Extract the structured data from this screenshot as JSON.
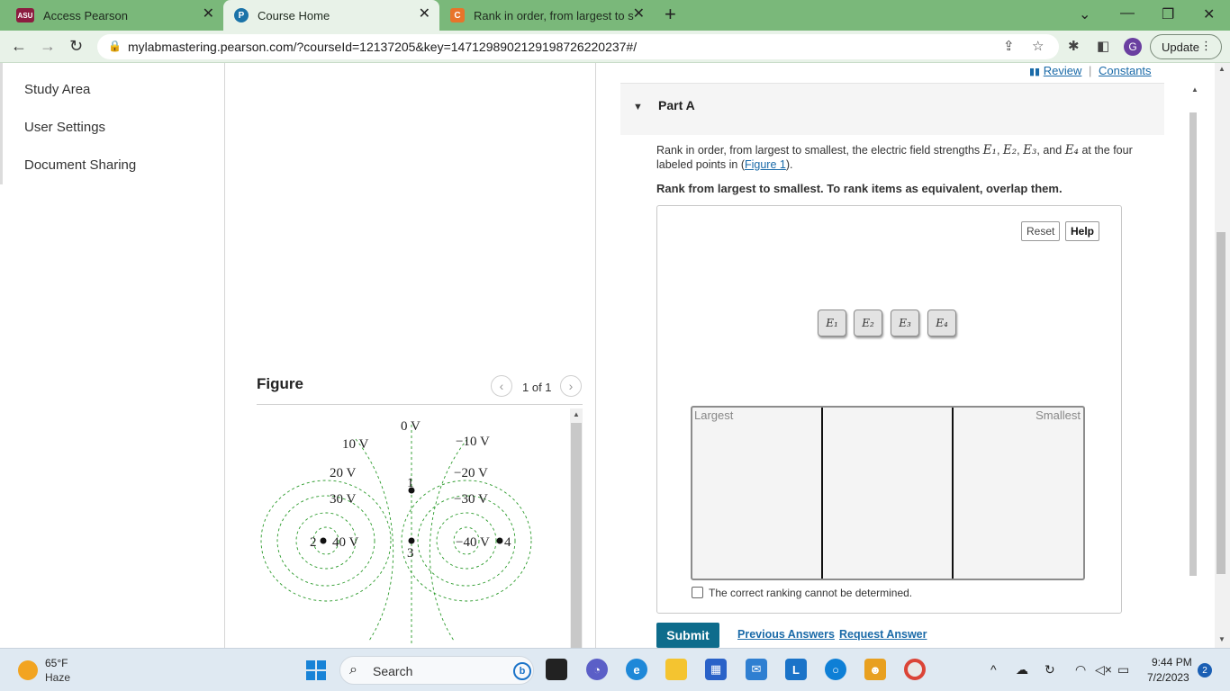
{
  "browser": {
    "tabs": [
      {
        "title": "Access Pearson",
        "favicon": "ASU"
      },
      {
        "title": "Course Home",
        "favicon": "P"
      },
      {
        "title": "Rank in order, from largest to sm",
        "favicon": "C"
      }
    ],
    "url": "mylabmastering.pearson.com/?courseId=12137205&key=1471298902129198726220237#/",
    "update_label": "Update",
    "profile_initial": "G"
  },
  "sidebar": {
    "items": [
      {
        "label": "Study Area"
      },
      {
        "label": "User Settings"
      },
      {
        "label": "Document Sharing"
      }
    ]
  },
  "figure": {
    "title": "Figure",
    "pager": "1 of 1",
    "equipotentials": {
      "top": "0 V",
      "left": [
        "10 V",
        "20 V",
        "30 V",
        "40 V"
      ],
      "right": [
        "−10 V",
        "−20 V",
        "−30 V",
        "−40 V"
      ]
    },
    "points": [
      "1",
      "2",
      "3",
      "4"
    ]
  },
  "links": {
    "review": "Review",
    "separator": "|",
    "constants": "Constants"
  },
  "part": {
    "title": "Part A"
  },
  "question": {
    "text_before": "Rank in order, from largest to smallest, the electric field strengths ",
    "vars": [
      "E₁",
      "E₂",
      "E₃",
      "E₄"
    ],
    "text_middle": " at the four labeled points in (",
    "figure_link": "Figure 1",
    "text_after": ").",
    "sep1": ", ",
    "sep_and": ", and ",
    "instruction": "Rank from largest to smallest. To rank items as equivalent, overlap them."
  },
  "ranking": {
    "reset_label": "Reset",
    "help_label": "Help",
    "tiles": [
      "E₁",
      "E₂",
      "E₃",
      "E₄"
    ],
    "largest_label": "Largest",
    "smallest_label": "Smallest",
    "cannot_determine_label": "The correct ranking cannot be determined."
  },
  "actions": {
    "submit_label": "Submit",
    "previous_answers": "Previous Answers",
    "request_answer": "Request Answer"
  },
  "taskbar": {
    "weather_temp": "65°F",
    "weather_condition": "Haze",
    "search_placeholder": "Search",
    "time": "9:44 PM",
    "date": "7/2/2023",
    "notification_count": "2"
  },
  "colors": {
    "tabbar": "#7ab87a",
    "submit": "#0e6c8c",
    "link": "#1a6aa8",
    "figure_lines": "#2a9a2a"
  }
}
